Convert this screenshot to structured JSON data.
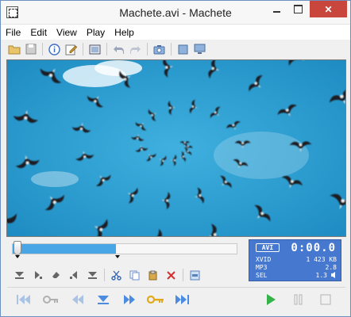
{
  "window": {
    "title": "Machete.avi - Machete"
  },
  "menu": [
    "File",
    "Edit",
    "View",
    "Play",
    "Help"
  ],
  "toolbar_icons": [
    "open-folder-icon",
    "save-icon",
    "info-icon",
    "edit-tags-icon",
    "film-frame-icon",
    "undo-icon",
    "redo-icon",
    "snapshot-camera-icon",
    "stop-square-icon",
    "monitor-icon"
  ],
  "seek": {
    "position": 0.0,
    "selection_end_fraction": 0.46
  },
  "status": {
    "format": "AVI",
    "time": "0:00.0",
    "rows": [
      {
        "key": "XVID",
        "value": "1 423 KB"
      },
      {
        "key": "MP3",
        "value": "2.8"
      },
      {
        "key": "SEL",
        "value": "1.3"
      }
    ]
  },
  "edit_icons": [
    "mark-in-icon",
    "mark-out-icon",
    "clear-icon",
    "prev-mark-icon",
    "next-mark-icon",
    "cut-icon",
    "copy-icon",
    "paste-icon",
    "delete-icon",
    "clip-icon"
  ],
  "transport_icons": [
    "go-start-icon",
    "prev-key-icon",
    "step-back-icon",
    "goto-selection-icon",
    "step-forward-icon",
    "next-key-icon",
    "go-end-icon",
    "play-icon",
    "pause-icon",
    "stop-icon"
  ],
  "colors": {
    "accent": "#4778cf",
    "seek_fill": "#48a6e6",
    "close": "#c9463d",
    "sky": "#2a9ac8"
  }
}
